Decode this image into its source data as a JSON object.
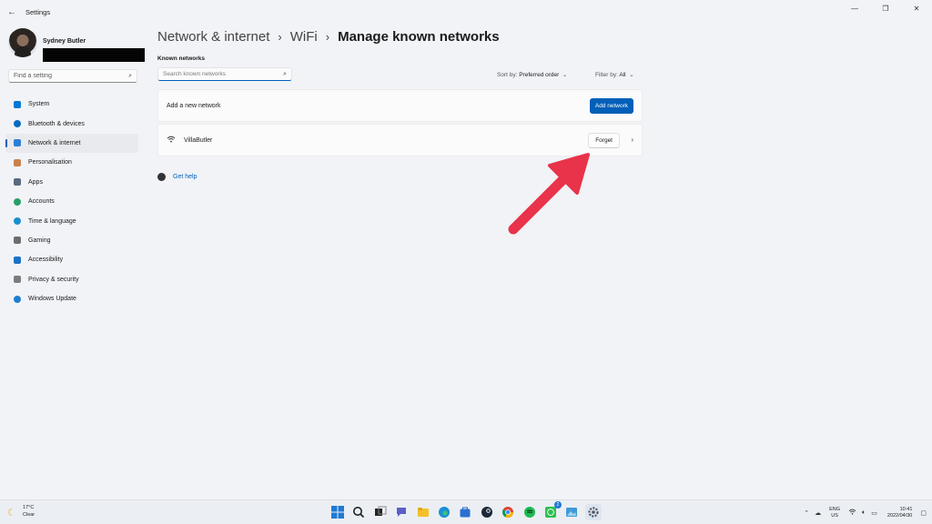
{
  "window": {
    "title": "Settings",
    "controls": [
      "—",
      "❐",
      "✕"
    ]
  },
  "profile": {
    "name": "Sydney Butler"
  },
  "sidebar": {
    "search_placeholder": "Find a setting",
    "items": [
      {
        "label": "System",
        "icon": "system-icon",
        "color": "#0078d4"
      },
      {
        "label": "Bluetooth & devices",
        "icon": "bluetooth-icon",
        "color": "#0a6cbf"
      },
      {
        "label": "Network & internet",
        "icon": "network-icon",
        "color": "#2b80d6",
        "active": true
      },
      {
        "label": "Personalisation",
        "icon": "brush-icon",
        "color": "#c9824c"
      },
      {
        "label": "Apps",
        "icon": "apps-icon",
        "color": "#5a6b80"
      },
      {
        "label": "Accounts",
        "icon": "accounts-icon",
        "color": "#27a068"
      },
      {
        "label": "Time & language",
        "icon": "globe-icon",
        "color": "#1b8fd1"
      },
      {
        "label": "Gaming",
        "icon": "gaming-icon",
        "color": "#6d6d6d"
      },
      {
        "label": "Accessibility",
        "icon": "accessibility-icon",
        "color": "#1a73c8"
      },
      {
        "label": "Privacy & security",
        "icon": "shield-icon",
        "color": "#7c7c7c"
      },
      {
        "label": "Windows Update",
        "icon": "update-icon",
        "color": "#1d7fd2"
      }
    ]
  },
  "breadcrumb": {
    "part1": "Network & internet",
    "part2": "WiFi",
    "current": "Manage known networks",
    "separator": "›"
  },
  "main": {
    "section_label": "Known networks",
    "search_placeholder": "Search known networks",
    "sort_label": "Sort by:",
    "sort_value": "Preferred order",
    "filter_label": "Filter by:",
    "filter_value": "All",
    "add_row_label": "Add a new network",
    "add_button": "Add network",
    "network_name": "VillaButler",
    "forget_button": "Forget",
    "help_link": "Get help"
  },
  "taskbar": {
    "temp": "17°C",
    "condition": "Clear",
    "lang_top": "ENG",
    "lang_bottom": "US",
    "time": "10:41",
    "date": "2022/04/30",
    "badge_count": "2"
  },
  "colors": {
    "accent": "#005fb8",
    "arrow": "#e8334a"
  }
}
